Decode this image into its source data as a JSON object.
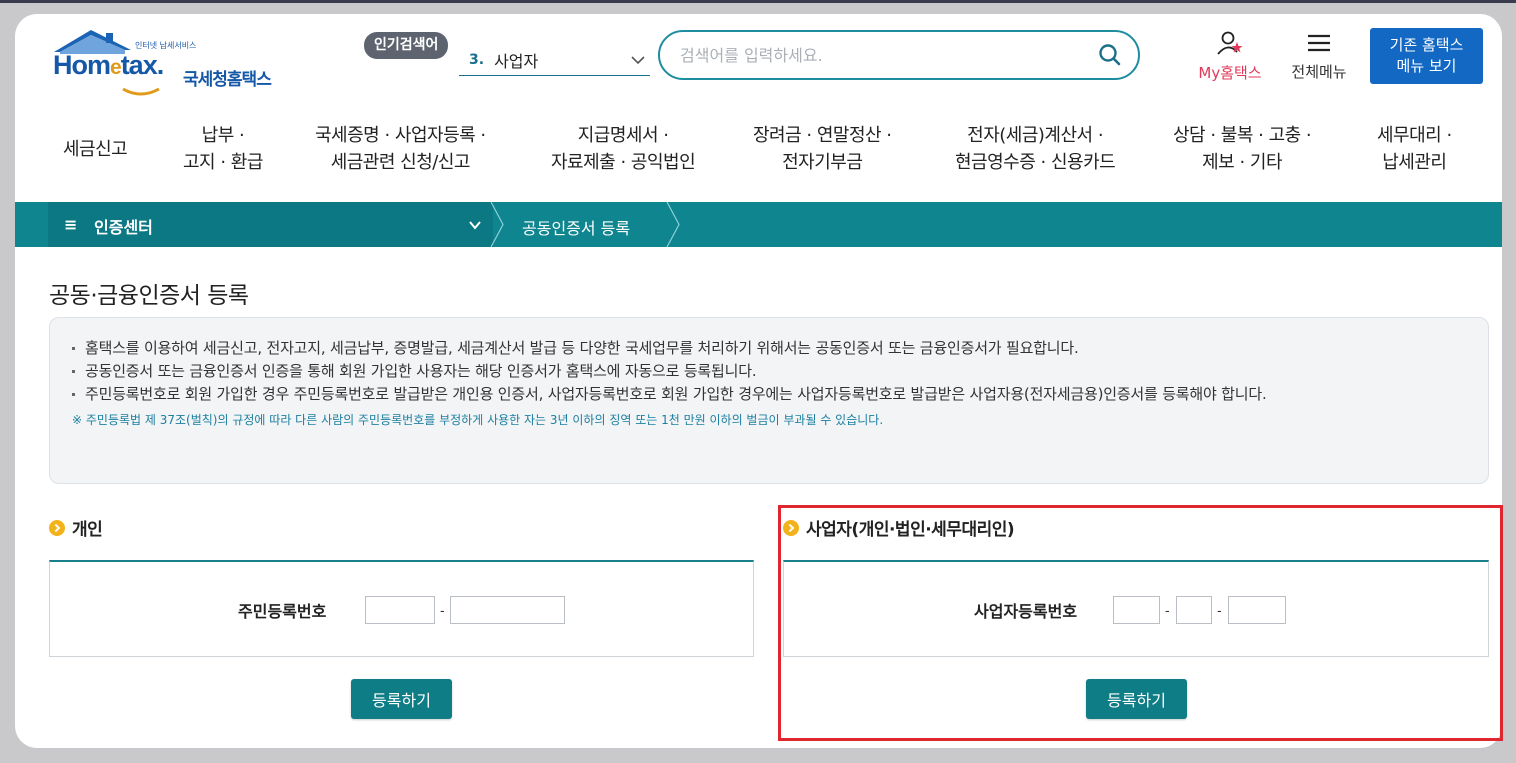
{
  "header": {
    "logo_small": "인터넷 납세서비스",
    "logo_en_prefix": "Hom",
    "logo_en_e": "e",
    "logo_en_suffix": "tax.",
    "logo_ko": "국세청홈택스",
    "popular_badge": "인기검색어",
    "popular_rank": "3.",
    "popular_word": "사업자",
    "search_placeholder": "검색어를 입력하세요.",
    "my_hometax": "My홈택스",
    "all_menu": "전체메뉴",
    "old_menu_line1": "기존 홈택스",
    "old_menu_line2": "메뉴 보기"
  },
  "gnb": [
    {
      "line1": "세금신고",
      "line2": ""
    },
    {
      "line1": "납부 ·",
      "line2": "고지 · 환급"
    },
    {
      "line1": "국세증명 · 사업자등록 ·",
      "line2": "세금관련 신청/신고"
    },
    {
      "line1": "지급명세서 ·",
      "line2": "자료제출 · 공익법인"
    },
    {
      "line1": "장려금 · 연말정산 ·",
      "line2": "전자기부금"
    },
    {
      "line1": "전자(세금)계산서 ·",
      "line2": "현금영수증 · 신용카드"
    },
    {
      "line1": "상담 · 불복 · 고충 ·",
      "line2": "제보 · 기타"
    },
    {
      "line1": "세무대리 ·",
      "line2": "납세관리"
    }
  ],
  "location": {
    "menu_icon": "≡",
    "center": "인증센터",
    "page": "공동인증서 등록"
  },
  "content": {
    "title": "공동·금융인증서 등록",
    "notices": [
      "홈택스를 이용하여 세금신고, 전자고지, 세금납부, 증명발급, 세금계산서 발급 등 다양한 국세업무를 처리하기 위해서는 공동인증서 또는 금융인증서가 필요합니다.",
      "공동인증서 또는 금융인증서 인증을 통해 회원 가입한 사용자는 해당 인증서가 홈택스에 자동으로 등록됩니다.",
      "주민등록번호로 회원 가입한 경우 주민등록번호로 발급받은 개인용 인증서, 사업자등록번호로 회원 가입한 경우에는 사업자등록번호로 발급받은 사업자용(전자세금용)인증서를 등록해야 합니다."
    ],
    "warning": "※ 주민등록법 제 37조(벌칙)의 규정에 따라 다른 사람의 주민등록번호를 부정하게 사용한 자는 3년 이하의 징역 또는 1천 만원 이하의 벌금이 부과될 수 있습니다.",
    "personal": {
      "title": "개인",
      "label": "주민등록번호",
      "dash": "-",
      "button": "등록하기"
    },
    "business": {
      "title": "사업자(개인·법인·세무대리인)",
      "label": "사업자등록번호",
      "dash": "-",
      "button": "등록하기"
    }
  },
  "colors": {
    "teal": "#0e858f",
    "blue_button": "#1368c4",
    "highlight": "#e0262e",
    "my_hometax": "#e0395a"
  }
}
